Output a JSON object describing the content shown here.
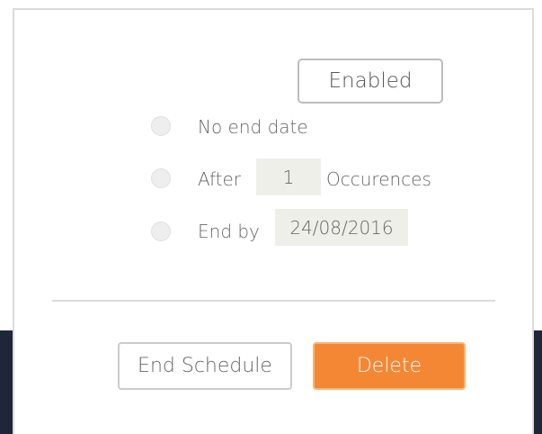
{
  "status_button": {
    "label": "Enabled"
  },
  "end_options": [
    {
      "label": "No end date"
    },
    {
      "label": "After",
      "value": "1",
      "suffix": "Occurences"
    },
    {
      "label": "End by",
      "value": "24/08/2016"
    }
  ],
  "actions": {
    "end_schedule_label": "End Schedule",
    "delete_label": "Delete"
  },
  "colors": {
    "accent": "#f48734",
    "backdrop": "#1d2738",
    "field_background": "#efefea"
  }
}
